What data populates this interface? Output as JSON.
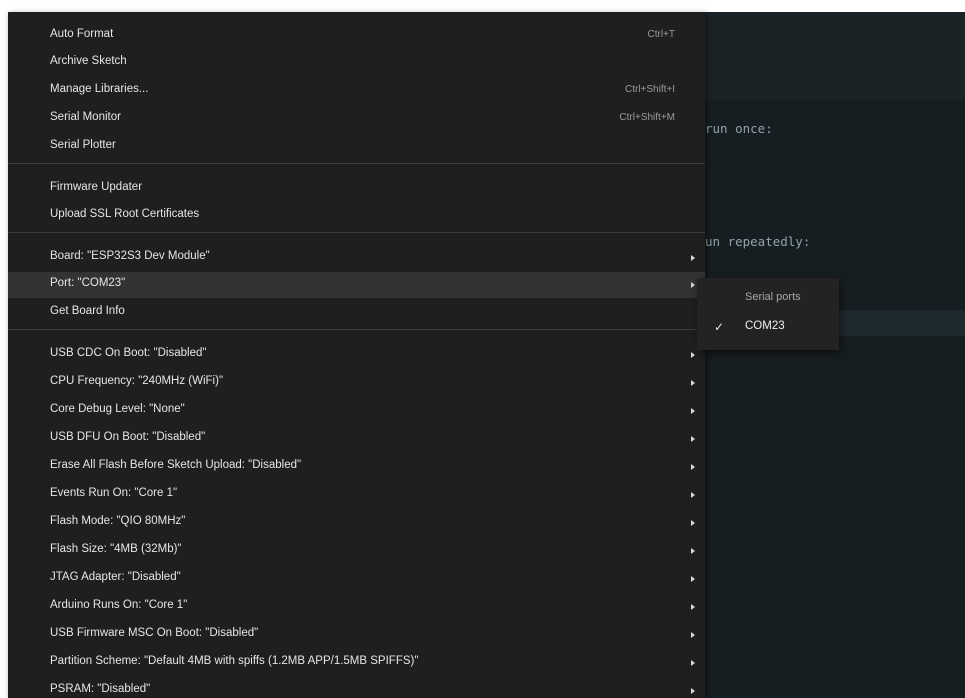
{
  "code_fragments": {
    "line1": "run once:",
    "line2": "un repeatedly:"
  },
  "menu": {
    "items": [
      {
        "label": "Auto Format",
        "shortcut": "Ctrl+T"
      },
      {
        "label": "Archive Sketch"
      },
      {
        "label": "Manage Libraries...",
        "shortcut": "Ctrl+Shift+I"
      },
      {
        "label": "Serial Monitor",
        "shortcut": "Ctrl+Shift+M"
      },
      {
        "label": "Serial Plotter"
      },
      {
        "label": "Firmware Updater"
      },
      {
        "label": "Upload SSL Root Certificates"
      },
      {
        "label": "Board: \"ESP32S3 Dev Module\"",
        "submenu": true
      },
      {
        "label": "Port: \"COM23\"",
        "submenu": true,
        "active": true
      },
      {
        "label": "Get Board Info"
      },
      {
        "label": "USB CDC On Boot: \"Disabled\"",
        "submenu": true
      },
      {
        "label": "CPU Frequency: \"240MHz (WiFi)\"",
        "submenu": true
      },
      {
        "label": "Core Debug Level: \"None\"",
        "submenu": true
      },
      {
        "label": "USB DFU On Boot: \"Disabled\"",
        "submenu": true
      },
      {
        "label": "Erase All Flash Before Sketch Upload: \"Disabled\"",
        "submenu": true
      },
      {
        "label": "Events Run On: \"Core 1\"",
        "submenu": true
      },
      {
        "label": "Flash Mode: \"QIO 80MHz\"",
        "submenu": true
      },
      {
        "label": "Flash Size: \"4MB (32Mb)\"",
        "submenu": true
      },
      {
        "label": "JTAG Adapter: \"Disabled\"",
        "submenu": true
      },
      {
        "label": "Arduino Runs On: \"Core 1\"",
        "submenu": true
      },
      {
        "label": "USB Firmware MSC On Boot: \"Disabled\"",
        "submenu": true
      },
      {
        "label": "Partition Scheme: \"Default 4MB with spiffs (1.2MB APP/1.5MB SPIFFS)\"",
        "submenu": true
      },
      {
        "label": "PSRAM: \"Disabled\"",
        "submenu": true
      }
    ]
  },
  "port_submenu": {
    "header": "Serial ports",
    "items": [
      {
        "label": "COM23",
        "checked": true,
        "check_icon": "check-icon"
      }
    ]
  },
  "colors": {
    "menu_background": "#1f1f1f",
    "menu_active": "#313335",
    "editor_background": "#171e21"
  }
}
